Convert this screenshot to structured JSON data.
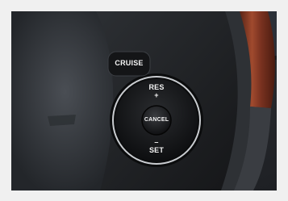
{
  "controls": {
    "cruise_label": "CRUISE",
    "res_label": "RES",
    "plus_label": "+",
    "cancel_label": "CANCEL",
    "minus_label": "–",
    "set_label": "SET"
  },
  "colors": {
    "leather": "#3b3f45",
    "leather_dark": "#2a2d31",
    "wood": "#8a3a26",
    "chrome": "#c9ccd0",
    "button": "#1b1c1e",
    "label": "#f4f4f4"
  }
}
